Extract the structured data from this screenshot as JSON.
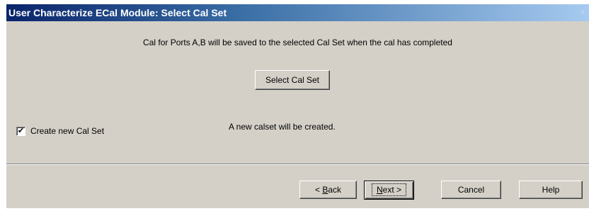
{
  "dialog": {
    "title": "User Characterize ECal Module: Select Cal Set",
    "close_glyph": "x"
  },
  "main": {
    "info_text": "Cal for Ports A,B will be saved to the selected Cal Set when the cal has completed",
    "select_cal_set_label": "Select Cal Set",
    "create_new_label": "Create new Cal Set",
    "create_new_checked": true,
    "status_text": "A new calset will be created."
  },
  "footer": {
    "back_prefix": "< ",
    "back_mnemonic": "B",
    "back_rest": "ack",
    "next_mnemonic": "N",
    "next_rest": "ext >",
    "cancel_label": "Cancel",
    "help_label": "Help"
  },
  "colors": {
    "title_start": "#0a246a",
    "title_end": "#a6caf0",
    "face": "#d4d0c8"
  }
}
